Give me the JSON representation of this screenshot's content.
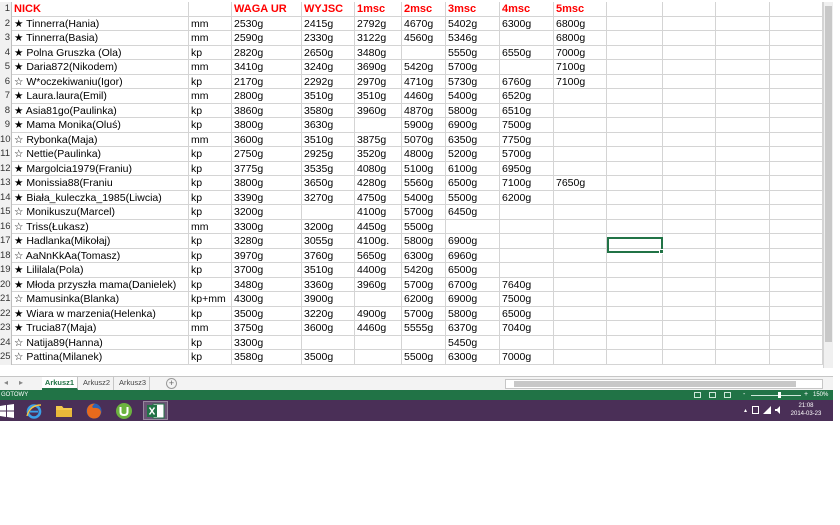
{
  "sheet": {
    "headers": [
      "NICK",
      "",
      "WAGA UR",
      "WYJSC",
      "1msc",
      "2msc",
      "3msc",
      "4msc",
      "5msc"
    ],
    "rows": [
      {
        "num": "2",
        "nick": "★ Tinnerra(Hania)",
        "type": "mm",
        "waga": "2530g",
        "wyjsc": "2415g",
        "m1": "2792g",
        "m2": "4670g",
        "m3": "5402g",
        "m4": "6300g",
        "m5": "6800g"
      },
      {
        "num": "3",
        "nick": "★ Tinnerra(Basia)",
        "type": "mm",
        "waga": "2590g",
        "wyjsc": "2330g",
        "m1": "3122g",
        "m2": "4560g",
        "m3": "5346g",
        "m4": "",
        "m5": "6800g"
      },
      {
        "num": "4",
        "nick": "★ Polna Gruszka (Ola)",
        "type": "kp",
        "waga": "2820g",
        "wyjsc": "2650g",
        "m1": "3480g",
        "m2": "",
        "m3": "5550g",
        "m4": "6550g",
        "m5": "7000g"
      },
      {
        "num": "5",
        "nick": "★ Daria872(Nikodem)",
        "type": "mm",
        "waga": "3410g",
        "wyjsc": "3240g",
        "m1": "3690g",
        "m2": "5420g",
        "m3": "5700g",
        "m4": "",
        "m5": "7100g"
      },
      {
        "num": "6",
        "nick": "☆ W*oczekiwaniu(Igor)",
        "type": "kp",
        "waga": "2170g",
        "wyjsc": "2292g",
        "m1": "2970g",
        "m2": "4710g",
        "m3": "5730g",
        "m4": "6760g",
        "m5": "7100g"
      },
      {
        "num": "7",
        "nick": "★ Laura.laura(Emil)",
        "type": "mm",
        "waga": "2800g",
        "wyjsc": "3510g",
        "m1": "3510g",
        "m2": "4460g",
        "m3": "5400g",
        "m4": "6520g",
        "m5": ""
      },
      {
        "num": "8",
        "nick": "★ Asia81go(Paulinka)",
        "type": "kp",
        "waga": "3860g",
        "wyjsc": "3580g",
        "m1": "3960g",
        "m2": "4870g",
        "m3": "5800g",
        "m4": "6510g",
        "m5": ""
      },
      {
        "num": "9",
        "nick": "★ Mama Monika(Oluś)",
        "type": "kp",
        "waga": "3800g",
        "wyjsc": "3630g",
        "m1": "",
        "m2": "5900g",
        "m3": "6900g",
        "m4": "7500g",
        "m5": ""
      },
      {
        "num": "10",
        "nick": "☆ Rybonka(Maja)",
        "type": "mm",
        "waga": "3600g",
        "wyjsc": "3510g",
        "m1": "3875g",
        "m2": "5070g",
        "m3": "6350g",
        "m4": "7750g",
        "m5": ""
      },
      {
        "num": "11",
        "nick": "☆ Nettie(Paulinka)",
        "type": "kp",
        "waga": "2750g",
        "wyjsc": "2925g",
        "m1": "3520g",
        "m2": "4800g",
        "m3": "5200g",
        "m4": "5700g",
        "m5": ""
      },
      {
        "num": "12",
        "nick": "★ Margolcia1979(Franiu)",
        "type": "kp",
        "waga": "3775g",
        "wyjsc": "3535g",
        "m1": "4080g",
        "m2": "5100g",
        "m3": "6100g",
        "m4": "6950g",
        "m5": ""
      },
      {
        "num": "13",
        "nick": "★ Monissia88(Franiu",
        "type": "kp",
        "waga": "3800g",
        "wyjsc": "3650g",
        "m1": "4280g",
        "m2": "5560g",
        "m3": "6500g",
        "m4": "7100g",
        "m5": "7650g"
      },
      {
        "num": "14",
        "nick": "★ Biała_kuleczka_1985(Liwcia)",
        "type": "kp",
        "waga": "3390g",
        "wyjsc": "3270g",
        "m1": "4750g",
        "m2": "5400g",
        "m3": "5500g",
        "m4": "6200g",
        "m5": ""
      },
      {
        "num": "15",
        "nick": "☆ Monikuszu(Marcel)",
        "type": "kp",
        "waga": "3200g",
        "wyjsc": "",
        "m1": "4100g",
        "m2": "5700g",
        "m3": "6450g",
        "m4": "",
        "m5": ""
      },
      {
        "num": "16",
        "nick": "☆ Triss(Łukasz)",
        "type": "mm",
        "waga": "3300g",
        "wyjsc": "3200g",
        "m1": "4450g",
        "m2": "5500g",
        "m3": "",
        "m4": "",
        "m5": ""
      },
      {
        "num": "17",
        "nick": "★ Hadlanka(Mikołaj)",
        "type": "kp",
        "waga": "3280g",
        "wyjsc": "3055g",
        "m1": "4100g.",
        "m2": "5800g",
        "m3": "6900g",
        "m4": "",
        "m5": ""
      },
      {
        "num": "18",
        "nick": "☆ AaNnKkAa(Tomasz)",
        "type": "kp",
        "waga": "3970g",
        "wyjsc": "3760g",
        "m1": "5650g",
        "m2": "6300g",
        "m3": "6960g",
        "m4": "",
        "m5": ""
      },
      {
        "num": "19",
        "nick": "★ Lililala(Pola)",
        "type": "kp",
        "waga": "3700g",
        "wyjsc": "3510g",
        "m1": "4400g",
        "m2": "5420g",
        "m3": "6500g",
        "m4": "",
        "m5": ""
      },
      {
        "num": "20",
        "nick": "★ Młoda przyszła mama(Danielek)",
        "type": "kp",
        "waga": "3480g",
        "wyjsc": "3360g",
        "m1": "3960g",
        "m2": "5700g",
        "m3": "6700g",
        "m4": "7640g",
        "m5": ""
      },
      {
        "num": "21",
        "nick": "☆ Mamusinka(Blanka)",
        "type": "kp+mm",
        "waga": "4300g",
        "wyjsc": "3900g",
        "m1": "",
        "m2": "6200g",
        "m3": "6900g",
        "m4": "7500g",
        "m5": ""
      },
      {
        "num": "22",
        "nick": "★ Wiara w marzenia(Helenka)",
        "type": "kp",
        "waga": "3500g",
        "wyjsc": "3220g",
        "m1": "4900g",
        "m2": "5700g",
        "m3": "5800g",
        "m4": "6500g",
        "m5": ""
      },
      {
        "num": "23",
        "nick": "★ Trucia87(Maja)",
        "type": "mm",
        "waga": "3750g",
        "wyjsc": "3600g",
        "m1": "4460g",
        "m2": "5555g",
        "m3": "6370g",
        "m4": "7040g",
        "m5": ""
      },
      {
        "num": "24",
        "nick": "☆ Natija89(Hanna)",
        "type": "kp",
        "waga": "3300g",
        "wyjsc": "",
        "m1": "",
        "m2": "",
        "m3": "5450g",
        "m4": "",
        "m5": ""
      },
      {
        "num": "25",
        "nick": "☆ Pattina(Milanek)",
        "type": "kp",
        "waga": "3580g",
        "wyjsc": "3500g",
        "m1": "",
        "m2": "5500g",
        "m3": "6300g",
        "m4": "7000g",
        "m5": ""
      }
    ]
  },
  "tabs": {
    "sheets": [
      "Arkusz1",
      "Arkusz2",
      "Arkusz3"
    ],
    "active": "Arkusz1",
    "add_label": "+",
    "nav_prev": "◂",
    "nav_next": "▸"
  },
  "status": {
    "text": "GOTOWY",
    "zoom_minus": "-",
    "zoom_plus": "+",
    "zoom": "150%"
  },
  "taskbar": {
    "time": "21:08",
    "date": "2014-03-23",
    "apps": [
      "windows-start",
      "internet-explorer",
      "file-explorer",
      "firefox",
      "utorrent",
      "excel"
    ],
    "active_app": "excel"
  },
  "colors": {
    "header_red": "#ff0000",
    "excel_green": "#217346",
    "taskbar_purple": "#4a2f57"
  }
}
